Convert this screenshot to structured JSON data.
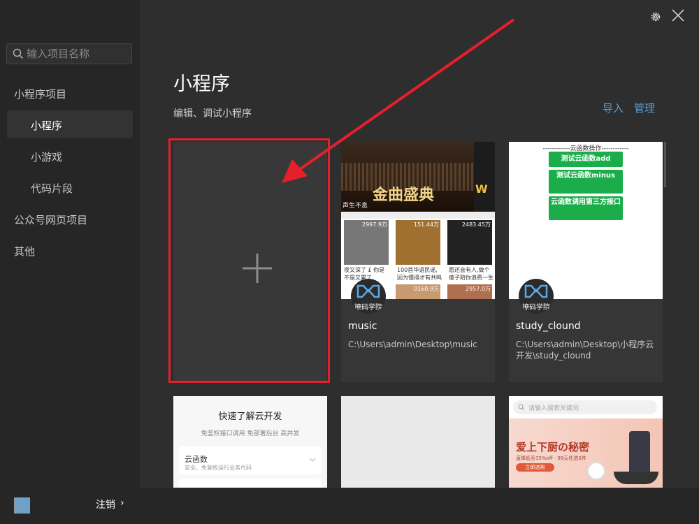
{
  "sidebar": {
    "search_placeholder": "输入项目名称",
    "section_miniprogram": "小程序项目",
    "items": [
      {
        "label": "小程序"
      },
      {
        "label": "小游戏"
      },
      {
        "label": "代码片段"
      }
    ],
    "section_official": "公众号网页项目",
    "section_other": "其他"
  },
  "footer": {
    "logout_label": "注销",
    "chevron": "›"
  },
  "main": {
    "title": "小程序",
    "subtitle": "编辑、调试小程序",
    "import_label": "导入",
    "manage_label": "管理"
  },
  "projects": [
    {
      "name": "music",
      "path": "C:\\Users\\admin\\Desktop\\music",
      "badge_text": "撩码学院",
      "thumb": {
        "banner_text": "金曲盛典",
        "banner_sub": "声生不息",
        "banner_right": "W",
        "tiles": [
          {
            "count": "2997.9万",
            "caption": "夜又深了 £ 你是不是又累了"
          },
          {
            "count": "151.44万",
            "caption": "100首华语民谣,因为懂得才有共鸣"
          },
          {
            "count": "2483.45万",
            "caption": "愿还会有人,做个傻子陪你浪费一生"
          },
          {
            "count": "0160.9万",
            "caption": ""
          },
          {
            "count": "2957.0万",
            "caption": ""
          }
        ]
      }
    },
    {
      "name": "study_clound",
      "path": "C:\\Users\\admin\\Desktop\\小程序云开发\\study_clound",
      "badge_text": "撩码学院",
      "thumb": {
        "header": "------------云函数操作------------",
        "buttons": [
          "测试云函数add",
          "测试云函数minus",
          "云函数调用第三方接口"
        ]
      }
    }
  ],
  "cloud_card": {
    "title": "快速了解云开发",
    "desc": "免鉴权接口调用 免部署后台 高并发",
    "item_title": "云函数",
    "item_desc": "安全、免鉴权运行业务代码"
  },
  "shop_card": {
    "search_placeholder": "请输入搜索关键词",
    "banner_title": "爱上下厨の秘密",
    "banner_sub": "直降低至35%off · 99元任选3件",
    "banner_btn": "立即选购"
  },
  "colors": {
    "accent_link": "#5a9fd8",
    "highlight_red": "#e5202a",
    "cloud_green": "#1aad4a"
  }
}
